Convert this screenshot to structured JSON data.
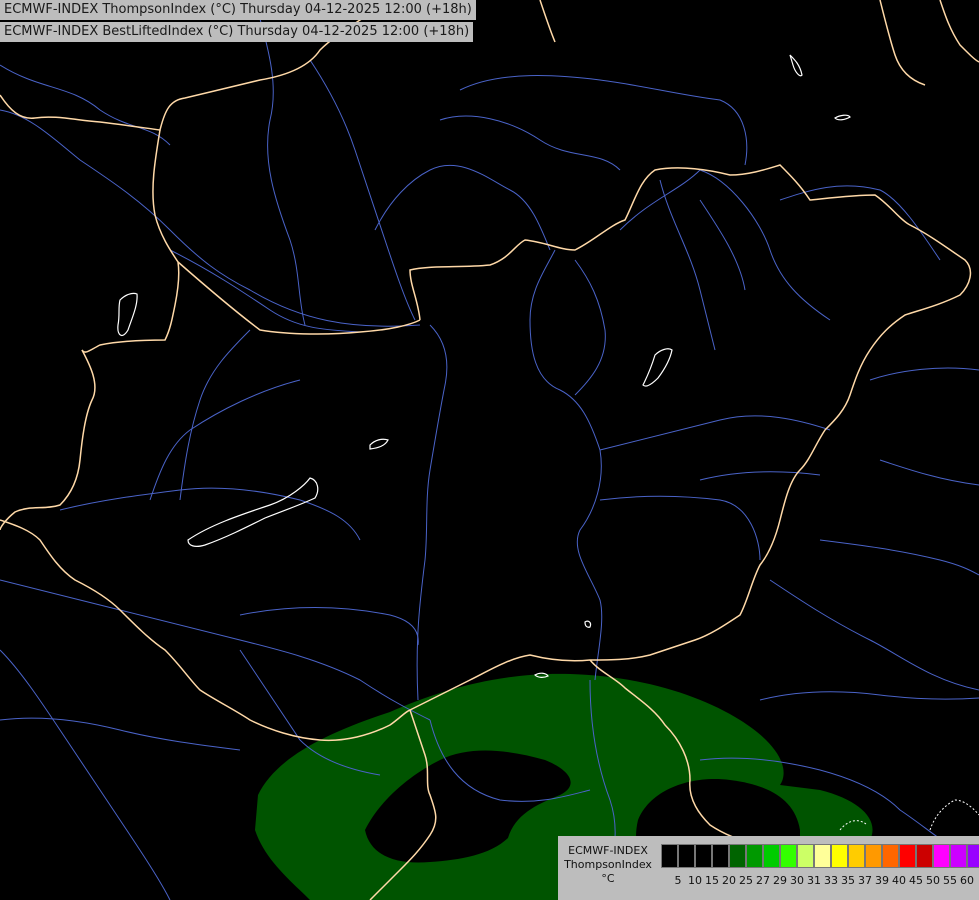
{
  "titles": {
    "line1": "ECMWF-INDEX ThompsonIndex (°C) Thursday 04-12-2025 12:00 (+18h)",
    "line2": "ECMWF-INDEX BestLiftedIndex (°C) Thursday 04-12-2025 12:00 (+18h)"
  },
  "legend": {
    "line1": "ECMWF-INDEX",
    "line2": "ThompsonIndex",
    "unit": "°C",
    "colors": [
      "#000000",
      "#000000",
      "#000000",
      "#000000",
      "#006400",
      "#009900",
      "#00cc00",
      "#33ff00",
      "#ccff66",
      "#ffff99",
      "#ffff00",
      "#ffcc00",
      "#ff9900",
      "#ff6600",
      "#ff0000",
      "#cc0000",
      "#ff00ff",
      "#cc00ff",
      "#9900ff",
      "#6600ff",
      "#0000ff"
    ],
    "ticks": [
      "5",
      "10",
      "15",
      "20",
      "25",
      "27",
      "29",
      "30",
      "31",
      "33",
      "35",
      "37",
      "39",
      "40",
      "45",
      "50",
      "55",
      "60"
    ]
  },
  "map_colors": {
    "background": "#000000",
    "border": "#ffd9a8",
    "river": "#4a63c8",
    "lake": "#ffffff",
    "index_fill": "#005400"
  }
}
